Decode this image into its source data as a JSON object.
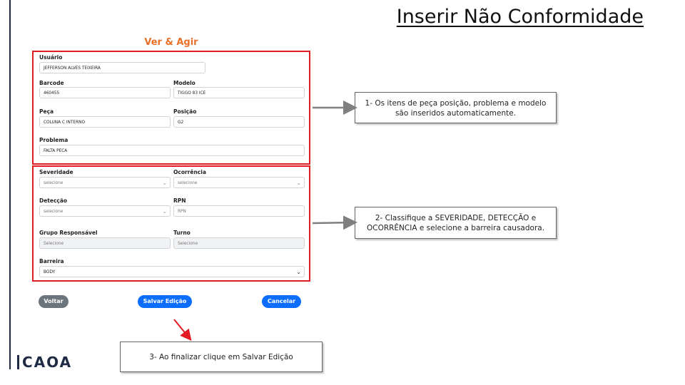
{
  "title": "Inserir Não Conformidade",
  "subtitle": "Ver & Agir",
  "form": {
    "usuario": {
      "label": "Usuário",
      "value": "JEFFERSON ALVES TEIXEIRA"
    },
    "barcode": {
      "label": "Barcode",
      "value": "460455"
    },
    "modelo": {
      "label": "Modelo",
      "value": "TIGGO 83 ICE"
    },
    "peca": {
      "label": "Peça",
      "value": "COLUNA C INTERNO"
    },
    "posicao": {
      "label": "Posição",
      "value": "G2"
    },
    "problema": {
      "label": "Problema",
      "value": "FALTA PECA"
    },
    "severidade": {
      "label": "Severidade",
      "value": "selecione"
    },
    "ocorrencia": {
      "label": "Ocorrência",
      "value": "selecione"
    },
    "deteccao": {
      "label": "Detecção",
      "value": "selecione"
    },
    "rpn": {
      "label": "RPN",
      "value": "RPN"
    },
    "grupo": {
      "label": "Grupo Responsável",
      "value": "Selecione"
    },
    "turno": {
      "label": "Turno",
      "value": "Selecione"
    },
    "barreira": {
      "label": "Barreira",
      "value": "BODY"
    }
  },
  "buttons": {
    "voltar": "Voltar",
    "salvar": "Salvar Edição",
    "cancelar": "Cancelar"
  },
  "callouts": {
    "c1_line1": "1- Os itens de peça posição, problema e modelo",
    "c1_line2": "são inseridos automaticamente.",
    "c2_line1": "2- Classifique a SEVERIDADE, DETECÇÃO e",
    "c2_line2": "OCORRÊNCIA e selecione a barreira causadora.",
    "c3": "3- Ao finalizar clique em Salvar Edição"
  },
  "logo": "CAOA",
  "colors": {
    "highlight": "#e31b23",
    "subtitle": "#e8702a",
    "primary": "#0d6efd",
    "secondary": "#6c757d",
    "arrow_gray": "#7f7f7f"
  }
}
